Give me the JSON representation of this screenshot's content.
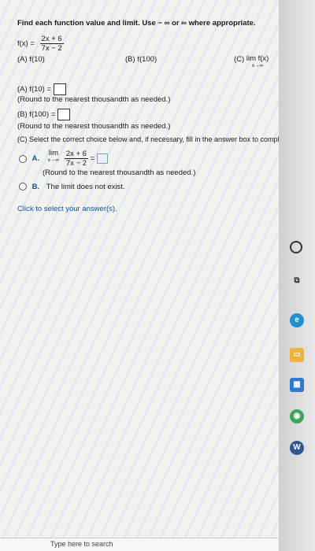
{
  "problem": {
    "heading": "Find each function value and limit. Use − ∞ or ∞ where appropriate.",
    "function": {
      "name": "f(x) =",
      "numerator": "2x + 6",
      "denominator": "7x − 2"
    },
    "parts": {
      "a_label": "(A) f(10)",
      "b_label": "(B) f(100)",
      "c_label": "(C)",
      "c_lim": "lim f(x)",
      "c_lim_sub": "x→∞"
    },
    "answer_a": {
      "prefix": "(A) f(10) =",
      "note": "(Round to the nearest thousandth as needed.)"
    },
    "answer_b": {
      "prefix": "(B) f(100) =",
      "note": "(Round to the nearest thousandth as needed.)"
    },
    "answer_c": {
      "prompt": "(C) Select the correct choice below and, if necessary, fill in the answer box to complete your choice.",
      "option_a_label": "A.",
      "option_a_lim": "lim",
      "option_a_sub": "x→∞",
      "option_a_num": "2x + 6",
      "option_a_den": "7x − 2",
      "option_a_eq": "=",
      "option_a_note": "(Round to the nearest thousandth as needed.)",
      "option_b_label": "B.",
      "option_b_text": "The limit does not exist."
    },
    "footer": "Click to select your answer(s)."
  },
  "taskbar": {
    "search_placeholder": "Type here to search",
    "icons": [
      "cortana-icon",
      "task-view-icon",
      "edge-icon",
      "file-explorer-icon",
      "store-icon",
      "chrome-icon",
      "word-icon"
    ],
    "accent_colors": {
      "edge": "#1f8fd6",
      "explorer": "#f2b233",
      "store": "#2b7ad8",
      "chrome": "#3aa657",
      "word": "#2b5797"
    }
  }
}
